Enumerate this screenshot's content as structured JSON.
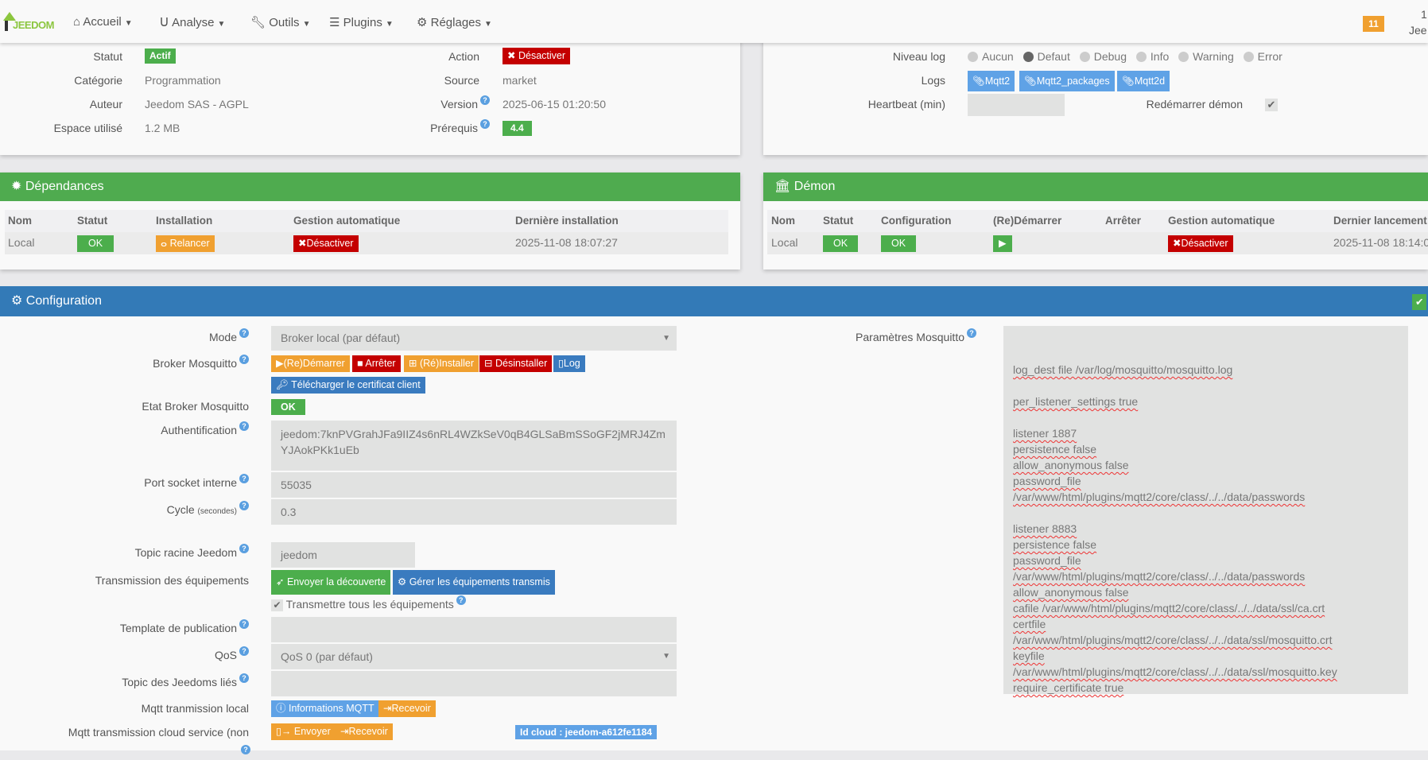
{
  "nav": {
    "logo": "JEEDOM",
    "items": [
      "Accueil",
      "Analyse",
      "Outils",
      "Plugins",
      "Réglages"
    ],
    "badge": "11",
    "user_line1": "1",
    "user_line2": "Jee"
  },
  "info": {
    "statut_label": "Statut",
    "statut": "Actif",
    "categorie_label": "Catégorie",
    "categorie": "Programmation",
    "auteur_label": "Auteur",
    "auteur": "Jeedom SAS - AGPL",
    "espace_label": "Espace utilisé",
    "espace": "1.2 MB",
    "action_label": "Action",
    "action_btn": "Désactiver",
    "source_label": "Source",
    "source": "market",
    "version_label": "Version",
    "version": "2025-06-15 01:20:50",
    "prerequis_label": "Prérequis",
    "prerequis": "4.4"
  },
  "logs": {
    "niveau_label": "Niveau log",
    "levels": [
      "Aucun",
      "Defaut",
      "Debug",
      "Info",
      "Warning",
      "Error"
    ],
    "selected": "Defaut",
    "logs_label": "Logs",
    "log_buttons": [
      "Mqtt2",
      "Mqtt2_packages",
      "Mqtt2d"
    ],
    "heartbeat_label": "Heartbeat (min)",
    "heartbeat_value": "",
    "restart_label": "Redémarrer démon",
    "restart_checked": true
  },
  "dependances": {
    "title": "Dépendances",
    "headers": [
      "Nom",
      "Statut",
      "Installation",
      "Gestion automatique",
      "Dernière installation"
    ],
    "row": {
      "nom": "Local",
      "statut": "OK",
      "installation": "Relancer",
      "gestion": "Désactiver",
      "derniere": "2025-11-08 18:07:27"
    }
  },
  "demon": {
    "title": "Démon",
    "headers": [
      "Nom",
      "Statut",
      "Configuration",
      "(Re)Démarrer",
      "Arrêter",
      "Gestion automatique",
      "Dernier lancement"
    ],
    "row": {
      "nom": "Local",
      "statut": "OK",
      "configuration": "OK",
      "gestion": "Désactiver",
      "dernier": "2025-11-08 18:14:0"
    }
  },
  "config": {
    "title": "Configuration",
    "mode_label": "Mode",
    "mode_value": "Broker local (par défaut)",
    "broker_label": "Broker Mosquitto",
    "broker_buttons": [
      "(Re)Démarrer",
      "Arrêter",
      "(Ré)Installer",
      "Désinstaller",
      "Log"
    ],
    "cert_button": "Télécharger le certificat client",
    "etat_label": "Etat Broker Mosquitto",
    "etat_value": "OK",
    "auth_label": "Authentification",
    "auth_value": "jeedom:7knPVGrahJFa9IIZ4s6nRL4WZkSeV0qB4GLSaBmSSoGF2jMRJ4ZmYJAokPKk1uEb",
    "port_label": "Port socket interne",
    "port_value": "55035",
    "cycle_label": "Cycle",
    "cycle_unit": "(secondes)",
    "cycle_value": "0.3",
    "topic_label": "Topic racine Jeedom",
    "topic_value": "jeedom",
    "trans_label": "Transmission des équipements",
    "trans_buttons": [
      "Envoyer la découverte",
      "Gérer les équipements transmis"
    ],
    "trans_all_label": "Transmettre tous les équipements",
    "template_label": "Template de publication",
    "template_value": "",
    "qos_label": "QoS",
    "qos_value": "QoS 0 (par défaut)",
    "linked_label": "Topic des Jeedoms liés",
    "linked_value": "",
    "local_label": "Mqtt tranmission local",
    "local_buttons": [
      "Informations MQTT",
      "Recevoir"
    ],
    "cloud_label": "Mqtt transmission cloud service (non",
    "cloud_buttons": [
      "Envoyer",
      "Recevoir"
    ],
    "cloud_id": "Id cloud : jeedom-a612fe1184",
    "mosq_label": "Paramètres Mosquitto",
    "mosq_lines": [
      "",
      "log_dest file /var/log/mosquitto/mosquitto.log",
      "",
      "per_listener_settings true",
      "",
      "listener 1887",
      "persistence false",
      "allow_anonymous false",
      "password_file",
      "/var/www/html/plugins/mqtt2/core/class/../../data/passwords",
      "",
      "listener 8883",
      "persistence false",
      "password_file",
      "/var/www/html/plugins/mqtt2/core/class/../../data/passwords",
      "allow_anonymous false",
      "cafile /var/www/html/plugins/mqtt2/core/class/../../data/ssl/ca.crt",
      "certfile",
      "/var/www/html/plugins/mqtt2/core/class/../../data/ssl/mosquitto.crt",
      "keyfile",
      "/var/www/html/plugins/mqtt2/core/class/../../data/ssl/mosquitto.key",
      "require_certificate true"
    ]
  }
}
